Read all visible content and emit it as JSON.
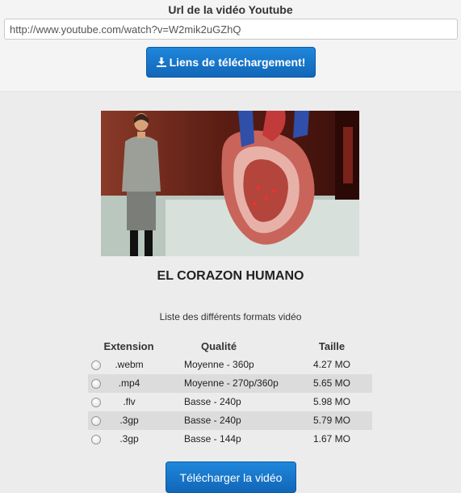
{
  "form": {
    "url_label": "Url de la vidéo Youtube",
    "url_value": "http://www.youtube.com/watch?v=W2mik2uGZhQ",
    "links_button": "Liens de téléchargement!"
  },
  "video": {
    "title": "EL CORAZON HUMANO",
    "formats_caption": "Liste des différents formats vidéo"
  },
  "table": {
    "headers": {
      "extension": "Extension",
      "quality": "Qualité",
      "size": "Taille"
    },
    "rows": [
      {
        "ext": ".webm",
        "quality": "Moyenne - 360p",
        "size": "4.27 MO"
      },
      {
        "ext": ".mp4",
        "quality": "Moyenne - 270p/360p",
        "size": "5.65 MO"
      },
      {
        "ext": ".flv",
        "quality": "Basse - 240p",
        "size": "5.98 MO"
      },
      {
        "ext": ".3gp",
        "quality": "Basse - 240p",
        "size": "5.79 MO"
      },
      {
        "ext": ".3gp",
        "quality": "Basse - 144p",
        "size": "1.67 MO"
      }
    ]
  },
  "download_button": "Télécharger la vidéo",
  "colors": {
    "button_blue": "#1a7ad2",
    "row_shade": "#dcdcdc"
  },
  "icons": {
    "download": "download-icon"
  }
}
